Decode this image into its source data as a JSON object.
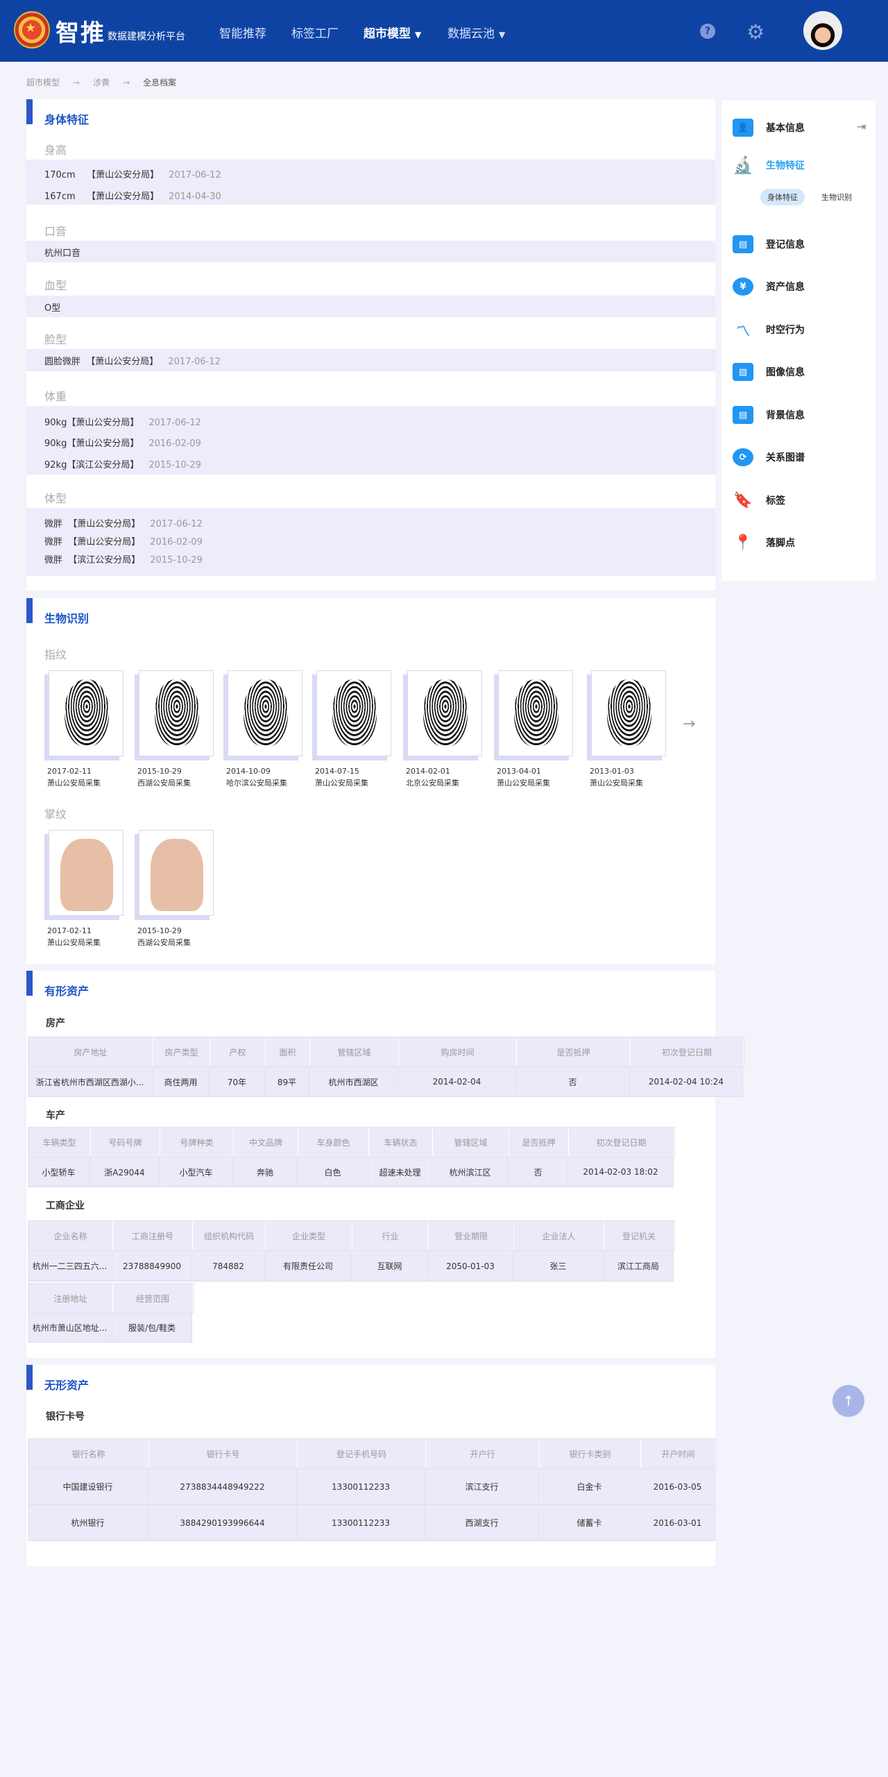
{
  "header": {
    "brand": "智推",
    "subtitle": "数据建模分析平台",
    "nav": [
      "智能推荐",
      "标签工厂",
      "超市模型",
      "数据云池"
    ]
  },
  "breadcrumb": [
    "超市模型",
    "涉黄",
    "全息档案"
  ],
  "physical": {
    "title": "身体特征",
    "height_label": "身高",
    "height": [
      {
        "v": "170cm",
        "s": "【萧山公安分局】",
        "d": "2017-06-12"
      },
      {
        "v": "167cm",
        "s": "【萧山公安分局】",
        "d": "2014-04-30"
      }
    ],
    "accent_label": "口音",
    "accent": "杭州口音",
    "blood_label": "血型",
    "blood": "O型",
    "face_label": "脸型",
    "face": {
      "v": "圆脸微胖",
      "s": "【萧山公安分局】",
      "d": "2017-06-12"
    },
    "weight_label": "体重",
    "weight": [
      {
        "v": "90kg",
        "s": "【萧山公安分局】",
        "d": "2017-06-12"
      },
      {
        "v": "90kg",
        "s": "【萧山公安分局】",
        "d": "2016-02-09"
      },
      {
        "v": "92kg",
        "s": "【滨江公安分局】",
        "d": "2015-10-29"
      }
    ],
    "build_label": "体型",
    "build": [
      {
        "v": "微胖",
        "s": "【萧山公安分局】",
        "d": "2017-06-12"
      },
      {
        "v": "微胖",
        "s": "【萧山公安分局】",
        "d": "2016-02-09"
      },
      {
        "v": "微胖",
        "s": "【滨江公安分局】",
        "d": "2015-10-29"
      }
    ]
  },
  "bio": {
    "title": "生物识别",
    "fp_label": "指纹",
    "fingerprints": [
      {
        "date": "2017-02-11",
        "src": "萧山公安局采集"
      },
      {
        "date": "2015-10-29",
        "src": "西湖公安局采集"
      },
      {
        "date": "2014-10-09",
        "src": "哈尔滨公安局采集"
      },
      {
        "date": "2014-07-15",
        "src": "萧山公安局采集"
      },
      {
        "date": "2014-02-01",
        "src": "北京公安局采集"
      },
      {
        "date": "2013-04-01",
        "src": "萧山公安局采集"
      },
      {
        "date": "2013-01-03",
        "src": "萧山公安局采集"
      }
    ],
    "palm_label": "掌纹",
    "palms": [
      {
        "date": "2017-02-11",
        "src": "萧山公安局采集"
      },
      {
        "date": "2015-10-29",
        "src": "西湖公安局采集"
      }
    ]
  },
  "tangible": {
    "title": "有形资产",
    "house_label": "房产",
    "house_headers": [
      "房产地址",
      "房产类型",
      "产权",
      "面积",
      "管辖区域",
      "购房时间",
      "是否抵押",
      "初次登记日期"
    ],
    "house_rows": [
      [
        "浙江省杭州市西湖区西湖小...",
        "商住两用",
        "70年",
        "89平",
        "杭州市西湖区",
        "2014-02-04",
        "否",
        "2014-02-04    10:24"
      ]
    ],
    "car_label": "车产",
    "car_headers": [
      "车辆类型",
      "号码号牌",
      "号牌种类",
      "中文品牌",
      "车身颜色",
      "车辆状态",
      "管辖区域",
      "是否抵押",
      "初次登记日期"
    ],
    "car_rows": [
      [
        "小型轿车",
        "浙A29044",
        "小型汽车",
        "奔驰",
        "白色",
        "超速未处理",
        "杭州滨江区",
        "否",
        "2014-02-03  18:02"
      ]
    ],
    "biz_label": "工商企业",
    "biz_headers": [
      "企业名称",
      "工商注册号",
      "组织机构代码",
      "企业类型",
      "行业",
      "营业期限",
      "企业法人",
      "登记机关"
    ],
    "biz_rows": [
      [
        "杭州一二三四五六...",
        "23788849900",
        "784882",
        "有限责任公司",
        "互联网",
        "2050-01-03",
        "张三",
        "滨江工商局"
      ]
    ],
    "biz_headers2": [
      "注册地址",
      "经营范围"
    ],
    "biz_rows2": [
      [
        "杭州市萧山区地址...",
        "服装/包/鞋类"
      ]
    ]
  },
  "intangible": {
    "title": "无形资产",
    "bank_label": "银行卡号",
    "bank_headers": [
      "银行名称",
      "银行卡号",
      "登记手机号码",
      "开户行",
      "银行卡类别",
      "开户时间"
    ],
    "bank_rows": [
      [
        "中国建设银行",
        "2738834448949222",
        "13300112233",
        "滨江支行",
        "白金卡",
        "2016-03-05"
      ],
      [
        "杭州银行",
        "3884290193996644",
        "13300112233",
        "西湖支行",
        "储蓄卡",
        "2016-03-01"
      ]
    ]
  },
  "sidebar": {
    "items": [
      "基本信息",
      "生物特征",
      "登记信息",
      "资产信息",
      "时空行为",
      "图像信息",
      "背景信息",
      "关系图谱",
      "标签",
      "落脚点"
    ],
    "chips": [
      "身体特征",
      "生物识别"
    ]
  }
}
